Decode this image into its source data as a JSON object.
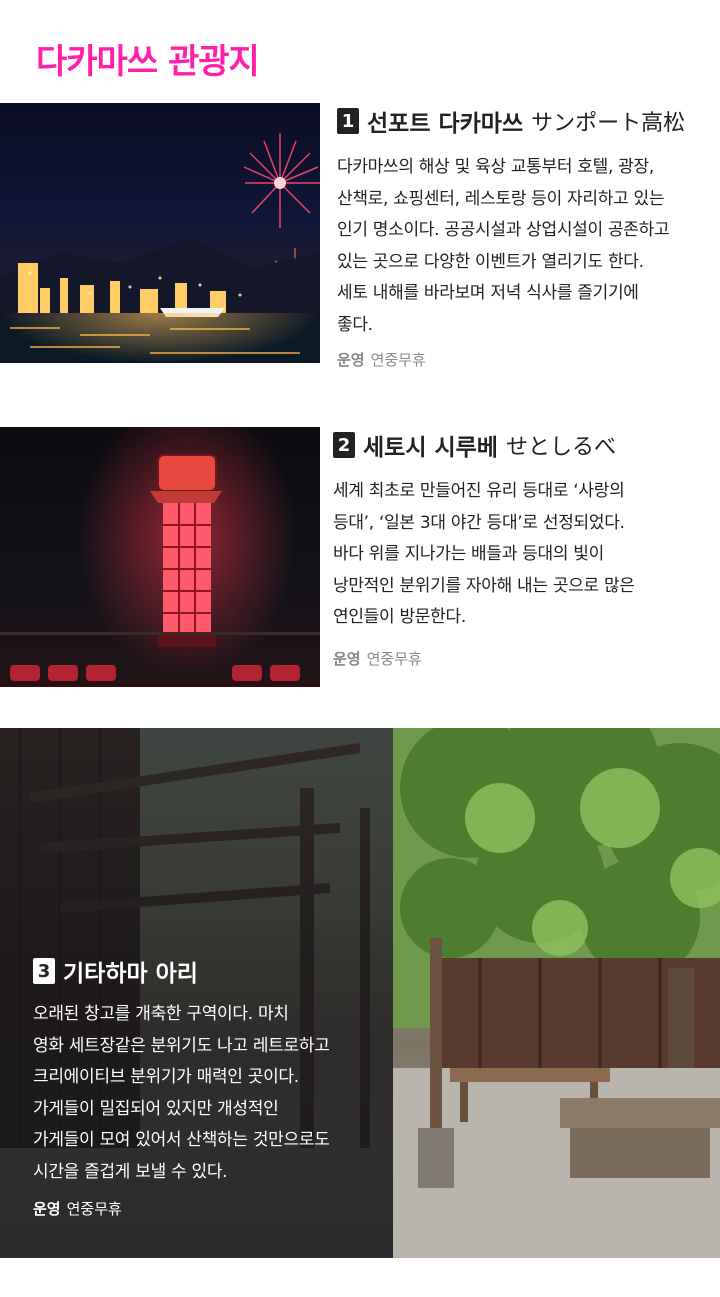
{
  "page_title": "다카마쓰 관광지",
  "sections": [
    {
      "number": "1",
      "title": "선포트 다카마쓰",
      "title_jp": "サンポート高松",
      "desc_lines": [
        "  다카마쓰의 해상 및 육상 교통부터 호텔, 광장,",
        "산책로, 쇼핑센터, 레스토랑 등이 자리하고 있는",
        "인기 명소이다. 공공시설과 상업시설이 공존하고",
        "있는 곳으로 다양한 이벤트가 열리기도 한다.",
        "세토 내해를 바라보며 저녁 식사를 즐기기에",
        "좋다."
      ],
      "op_label": "운영",
      "op_value": "연중무휴"
    },
    {
      "number": "2",
      "title": "세토시 시루베",
      "title_jp": "せとしるべ",
      "desc_lines": [
        "  세계 최초로 만들어진 유리 등대로 ‘사랑의",
        "등대’, ‘일본 3대 야간 등대’로 선정되었다.",
        "바다 위를 지나가는 배들과 등대의 빛이",
        "낭만적인 분위기를 자아해 내는 곳으로 많은",
        "연인들이 방문한다."
      ],
      "op_label": "운영",
      "op_value": "연중무휴"
    },
    {
      "number": "3",
      "title": "기타하마 아리",
      "desc_lines": [
        "  오래된 창고를 개축한 구역이다. 마치",
        "영화 세트장같은 분위기도 나고 레트로하고",
        "크리에이티브 분위기가 매력인 곳이다.",
        "가게들이 밀집되어 있지만 개성적인",
        "가게들이 모여 있어서 산책하는 것만으로도",
        "시간을 즐겁게 보낼 수 있다."
      ],
      "op_label": "운영",
      "op_value": "연중무휴"
    }
  ],
  "colors": {
    "title_pink": "#ff1fa8",
    "badge_dark": "#222222",
    "op_gray": "#888888"
  }
}
